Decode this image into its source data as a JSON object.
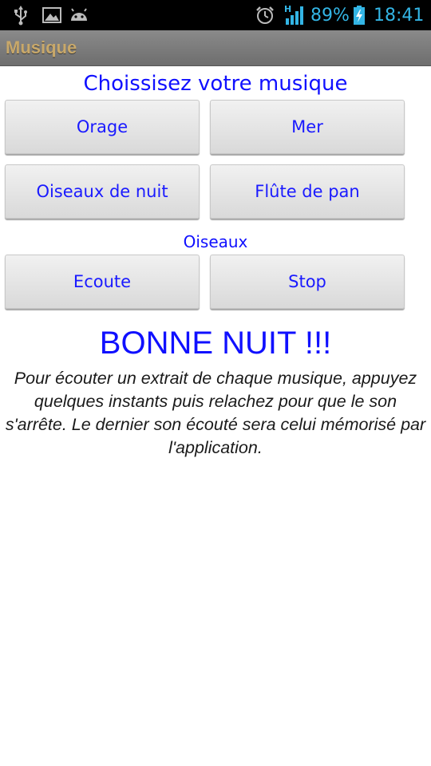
{
  "status_bar": {
    "icons": [
      "usb-icon",
      "image-icon",
      "android-icon",
      "alarm-icon",
      "signal-h-icon",
      "battery-charging-icon"
    ],
    "network_type": "H",
    "battery_percent": "89%",
    "clock": "18:41",
    "accent_color": "#33b5e5"
  },
  "title_bar": {
    "title": "Musique"
  },
  "main": {
    "choose_heading": "Choissisez votre musique",
    "music_buttons": [
      {
        "label": "Orage"
      },
      {
        "label": "Mer"
      },
      {
        "label": "Oiseaux de nuit"
      },
      {
        "label": "Flûte de pan"
      }
    ],
    "birds_label": "Oiseaux",
    "controls": {
      "listen_label": "Ecoute",
      "stop_label": "Stop"
    },
    "goodnight": "BONNE NUIT !!!",
    "instructions": "Pour écouter un extrait de chaque musique, appuyez quelques instants puis relachez pour que le son s'arrête. Le dernier son écouté sera celui mémorisé par l'application.",
    "text_color": "#1010ff"
  }
}
